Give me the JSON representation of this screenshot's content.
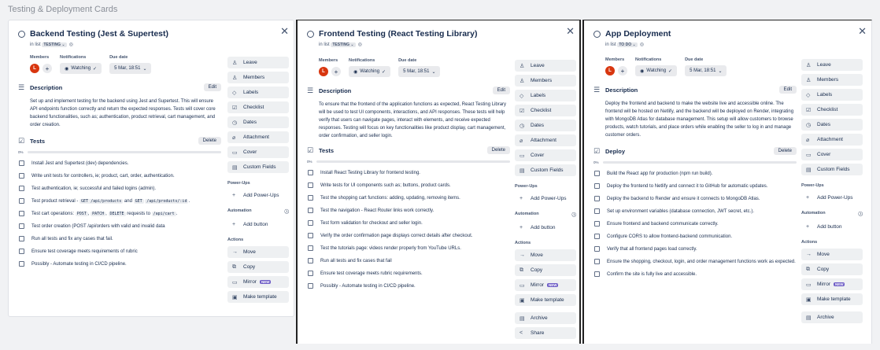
{
  "page": {
    "title": "Testing & Deployment Cards"
  },
  "common": {
    "in_list_prefix": "in list",
    "members_label": "Members",
    "notifications_label": "Notifications",
    "due_date_label": "Due date",
    "avatar_initial": "L",
    "watching": "Watching",
    "due_date": "5 Mar, 18:51",
    "description_title": "Description",
    "edit": "Edit",
    "delete": "Delete",
    "progress": "0%",
    "progress_value": 0,
    "powerups_label": "Power-Ups",
    "add_powerups": "Add Power-Ups",
    "automation_label": "Automation",
    "add_button": "Add button",
    "actions_label": "Actions",
    "new_badge": "NEW",
    "sidebar": {
      "leave": "Leave",
      "members": "Members",
      "labels": "Labels",
      "checklist": "Checklist",
      "dates": "Dates",
      "attachment": "Attachment",
      "cover": "Cover",
      "custom_fields": "Custom Fields"
    },
    "actions": {
      "move": "Move",
      "copy": "Copy",
      "mirror": "Mirror",
      "make_template": "Make template",
      "archive": "Archive",
      "share": "Share"
    }
  },
  "cards": [
    {
      "title": "Backend Testing (Jest & Supertest)",
      "list": "TESTING",
      "description": "Set up and implement testing for the backend using Jest and Supertest. This will ensure API endpoints function correctly and return the expected responses. Tests will cover core backend functionalities, such as; authentication, product retrieval, cart management, and order creation.",
      "checklist_title": "Tests",
      "items": [
        "Install Jest and Supertest (dev) dependencies.",
        "Write unit tests for controllers, ie; product, cart, order, authentication.",
        "Test authentication, ie; successful and failed logins (admin).",
        "Test cart operations:",
        "Test order creation (POST /api/orders with valid and invalid data",
        "Run all tests and fix any cases that fail.",
        "Ensure test coverage meets requirements of rubric",
        "Possibly - Automate testing in CI/CD pipeline."
      ],
      "rich": {
        "retrieval_prefix": "Test product retrieval -",
        "retrieval_code1": "GET /api/products",
        "and": "and",
        "retrieval_code2": "GET",
        "retrieval_code3": "/api/products/:id",
        "retrieval_suffix": ".",
        "cart_code1": "POST",
        "cart_code2": "PATCH",
        "cart_code3": "DELETE",
        "cart_mid": "requests to",
        "cart_code4": "/api/cart",
        "comma": ",",
        "dot": "."
      }
    },
    {
      "title": "Frontend Testing (React Testing Library)",
      "list": "TESTING",
      "description": "To ensure that the frontend of the application functions as expected, React Testing Library will be used to test UI components, interactions, and API responses. These tests will help verify that users can navigate pages, interact with elements, and receive expected responses. Testing will focus on key functionalities like product display, cart management, order confirmation, and seller login.",
      "checklist_title": "Tests",
      "items": [
        "Install React Testing Library for frontend testing.",
        "Write tests for UI components such as; buttons, product cards.",
        "Test the shopping cart functions: adding, updating, removing items.",
        "Test the navigation - React Router links work correctly.",
        "Test form validation for checkout and seller login.",
        "Verify the order confirmation page displays correct details after checkout.",
        "Test the tutorials page: videos render properly from YouTube URLs.",
        "Run all tests and fix cases that fail",
        "Ensure test coverage meets rubric requirements.",
        "Possibly - Automate testing in CI/CD pipeline."
      ]
    },
    {
      "title": "App Deployment",
      "list": "TO DO",
      "description": "Deploy the frontend and backend to make the website live and accessible online. The frontend will be hosted on Netlify, and the backend will be deployed on Render, integrating with MongoDB Atlas for database management. This setup will allow customers to browse products, watch tutorials, and place orders while enabling the seller to log in and manage customer orders.",
      "checklist_title": "Deploy",
      "items": [
        "Build the React app for production (npm run build).",
        "Deploy the frontend to Netlify and connect it to GitHub for automatic updates.",
        "Deploy the backend to Render and ensure it connects to MongoDB Atlas.",
        "Set up environment variables (database connection, JWT secret, etc.).",
        "Ensure frontend and backend communicate correctly.",
        "Configure CORS to allow frontend-backend communication.",
        "Verify that all frontend pages load correctly.",
        "Ensure the shopping, checkout, login, and order management functions work as expected.",
        "Confirm the site is fully live and accessible."
      ]
    }
  ]
}
